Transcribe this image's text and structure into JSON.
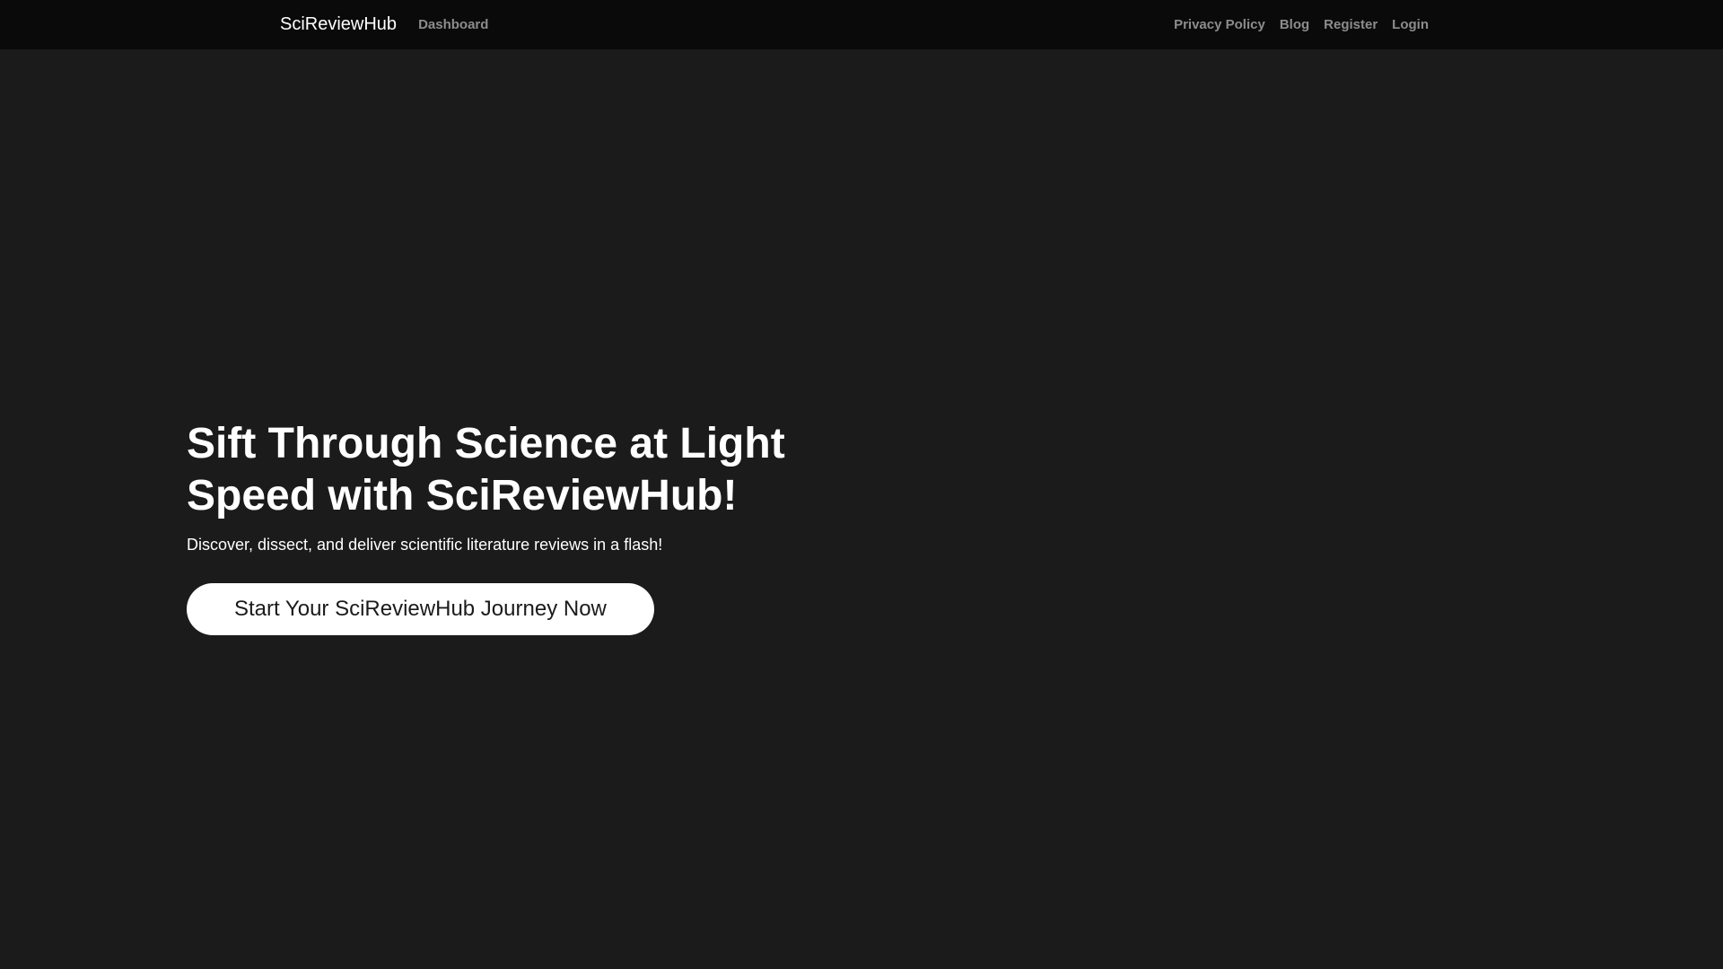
{
  "navbar": {
    "brand": "SciReviewHub",
    "left_links": [
      "Dashboard"
    ],
    "right_links": [
      "Privacy Policy",
      "Blog",
      "Register",
      "Login"
    ]
  },
  "hero": {
    "title": "Sift Through Science at Light Speed with SciReviewHub!",
    "subtitle": "Discover, dissect, and deliver scientific literature reviews in a flash!",
    "cta_label": "Start Your SciReviewHub Journey Now"
  },
  "colors": {
    "navbar_bg": "#0a0a0a",
    "page_bg": "#1b1b1b",
    "nav_link": "#8c8c8c",
    "cta_bg": "#ffffff"
  }
}
